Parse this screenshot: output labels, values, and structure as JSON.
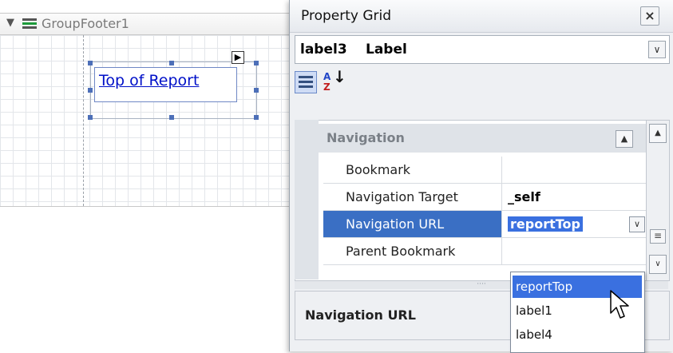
{
  "designer": {
    "band_name": "GroupFooter1",
    "label_text": "Top of Report"
  },
  "property_grid": {
    "title": "Property Grid",
    "selected_object": {
      "name": "label3",
      "type": "Label"
    },
    "category": "Navigation",
    "properties": [
      {
        "name": "Bookmark",
        "value": ""
      },
      {
        "name": "Navigation Target",
        "value": "_self"
      },
      {
        "name": "Navigation URL",
        "value": "reportTop"
      },
      {
        "name": "Parent Bookmark",
        "value": ""
      }
    ],
    "description_title": "Navigation URL",
    "dropdown_options": [
      "reportTop",
      "label1",
      "label4"
    ]
  }
}
